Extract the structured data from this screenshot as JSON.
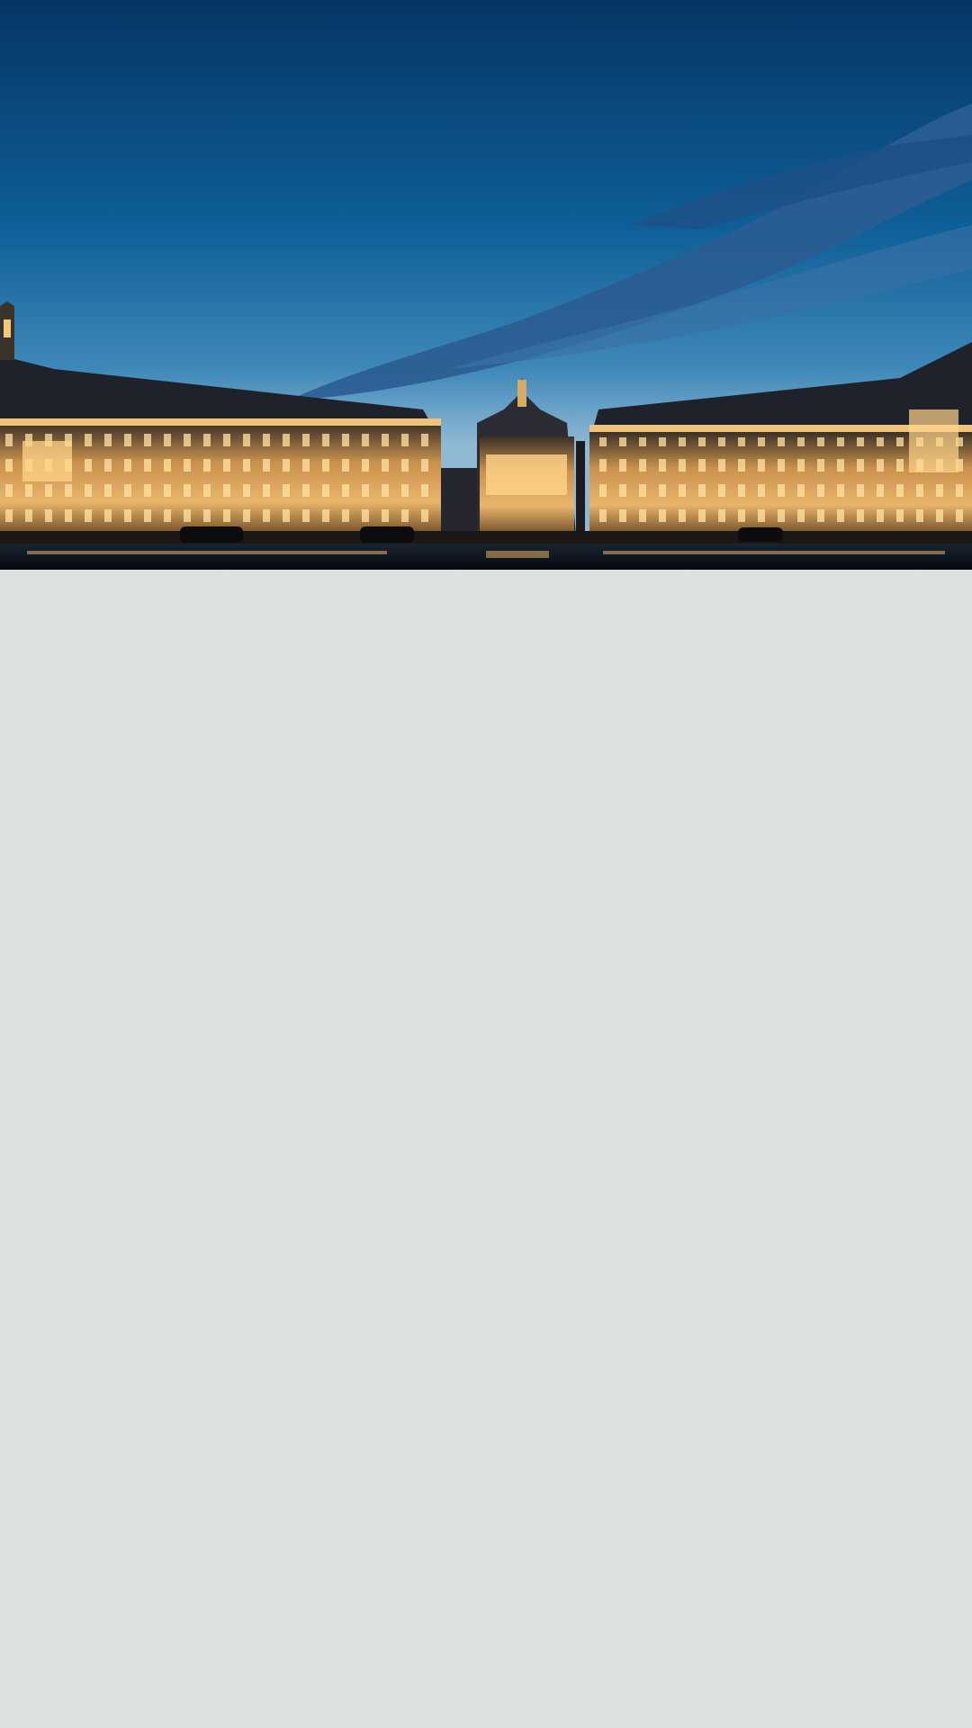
{
  "hero": {
    "subject": "illuminated-palace-square-at-dusk",
    "colors": {
      "sky_top": "#073d72",
      "sky_mid": "#2a7db0",
      "cloud": "#2c5f94",
      "building_light": "#f2c27a",
      "building_dark": "#2a2c34",
      "water": "#0d1620"
    }
  },
  "content": {
    "background_color": "#dbe2df"
  }
}
